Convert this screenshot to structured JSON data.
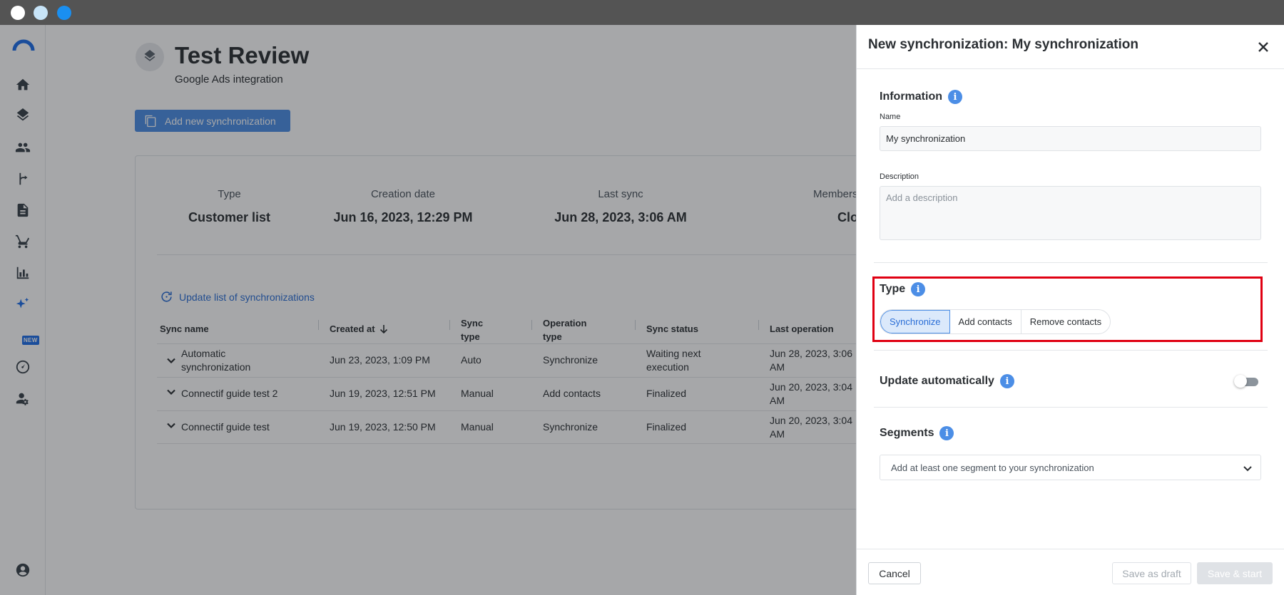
{
  "app": {
    "page_title": "Test Review",
    "page_subtitle": "Google Ads integration",
    "add_sync_button": "Add new synchronization",
    "new_badge": "NEW"
  },
  "stats": [
    {
      "label": "Type",
      "value": "Customer list"
    },
    {
      "label": "Creation date",
      "value": "Jun 16, 2023, 12:29 PM"
    },
    {
      "label": "Last sync",
      "value": "Jun 28, 2023, 3:06 AM"
    },
    {
      "label": "Members",
      "value": "Clo"
    }
  ],
  "update_link": "Update list of synchronizations",
  "table": {
    "headers": {
      "sync_name": "Sync name",
      "created_at": "Created at",
      "sync_type": "Sync type",
      "operation_type": "Operation type",
      "sync_status": "Sync status",
      "last_operation": "Last operation"
    },
    "rows": [
      {
        "name": "Automatic synchronization",
        "created": "Jun 23, 2023, 1:09 PM",
        "type": "Auto",
        "operation": "Synchronize",
        "status": "Waiting next execution",
        "last": "Jun 28, 2023, 3:06 AM"
      },
      {
        "name": "Connectif guide test 2",
        "created": "Jun 19, 2023, 12:51 PM",
        "type": "Manual",
        "operation": "Add contacts",
        "status": "Finalized",
        "last": "Jun 20, 2023, 3:04 AM"
      },
      {
        "name": "Connectif guide test",
        "created": "Jun 19, 2023, 12:50 PM",
        "type": "Manual",
        "operation": "Synchronize",
        "status": "Finalized",
        "last": "Jun 20, 2023, 3:04 AM"
      }
    ]
  },
  "drawer": {
    "title": "New synchronization: My synchronization",
    "information_title": "Information",
    "name_label": "Name",
    "name_value": "My synchronization",
    "description_label": "Description",
    "description_placeholder": "Add a description",
    "type_title": "Type",
    "type_options": [
      "Synchronize",
      "Add contacts",
      "Remove contacts"
    ],
    "type_selected": "Synchronize",
    "update_auto_title": "Update automatically",
    "update_auto_enabled": false,
    "segments_title": "Segments",
    "segments_placeholder": "Add at least one segment to your synchronization",
    "cancel_label": "Cancel",
    "draft_label": "Save as draft",
    "start_label": "Save & start"
  },
  "colors": {
    "accent": "#4c8ee6",
    "highlight_box": "#e00012"
  }
}
